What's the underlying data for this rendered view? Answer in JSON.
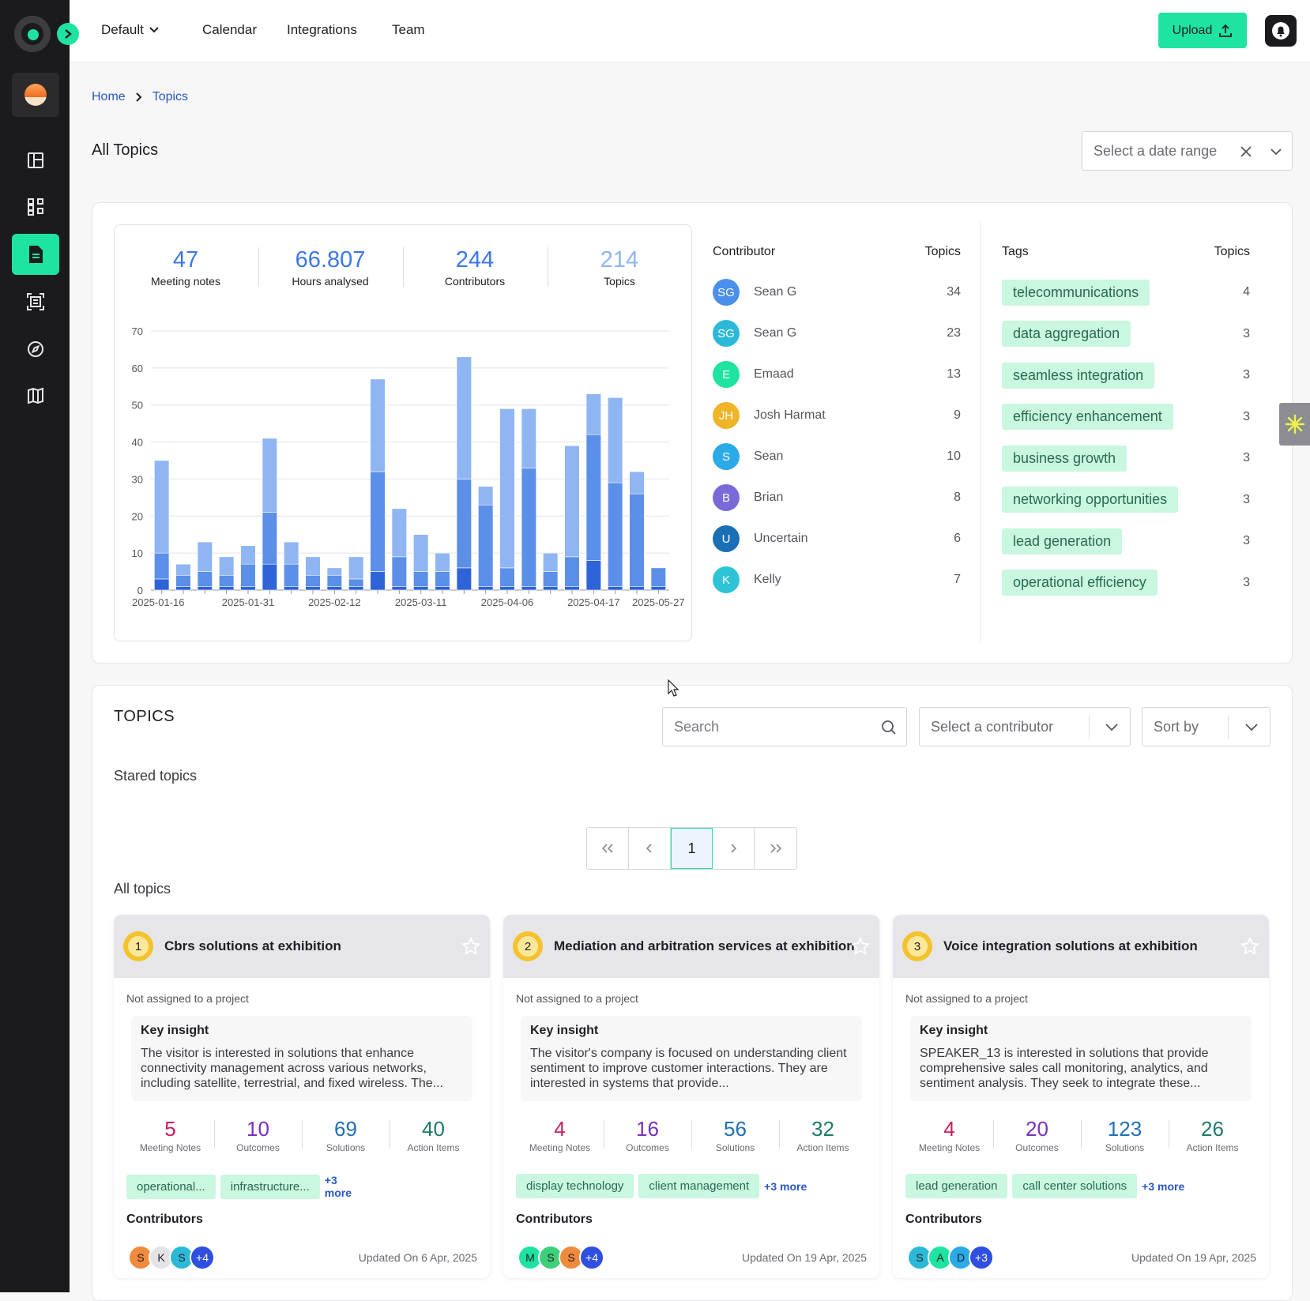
{
  "topbar": {
    "nav": [
      "Default",
      "Calendar",
      "Integrations",
      "Team"
    ],
    "upload_label": "Upload"
  },
  "sidebar": {
    "icons": [
      "dashboard-icon",
      "apps-icon",
      "document-icon",
      "scan-icon",
      "compass-icon",
      "map-icon"
    ],
    "active": "document-icon"
  },
  "breadcrumb": {
    "home": "Home",
    "current": "Topics"
  },
  "page": {
    "title": "All Topics",
    "date_placeholder": "Select a date range"
  },
  "stats": [
    {
      "value": "47",
      "label": "Meeting notes"
    },
    {
      "value": "66.807",
      "label": "Hours analysed"
    },
    {
      "value": "244",
      "label": "Contributors"
    },
    {
      "value": "214",
      "label": "Topics"
    }
  ],
  "chart_data": {
    "type": "bar",
    "stacked": true,
    "ylim": [
      0,
      70
    ],
    "yticks": [
      0,
      10,
      20,
      30,
      40,
      50,
      60,
      70
    ],
    "xtick_labels": [
      "2025-01-16",
      "2025-01-31",
      "2025-02-12",
      "2025-03-11",
      "2025-04-06",
      "2025-04-17",
      "2025-05-27"
    ],
    "grid": true,
    "series": [
      {
        "values": [
          3,
          1,
          1,
          1,
          1,
          7,
          1,
          1,
          1,
          1,
          5,
          1,
          1,
          1,
          6,
          1,
          1,
          1,
          1,
          1,
          8,
          1,
          1,
          1
        ]
      },
      {
        "values": [
          7,
          3,
          4,
          3,
          6,
          14,
          6,
          3,
          3,
          2,
          27,
          8,
          4,
          4,
          24,
          22,
          5,
          32,
          4,
          8,
          34,
          28,
          25,
          5
        ]
      },
      {
        "values": [
          25,
          3,
          8,
          5,
          5,
          20,
          6,
          5,
          2,
          6,
          25,
          13,
          10,
          5,
          33,
          5,
          43,
          16,
          5,
          30,
          11,
          23,
          6,
          0
        ]
      }
    ],
    "colors": [
      "#2f64d8",
      "#5b8fe8",
      "#8fb5f2"
    ]
  },
  "contributors": {
    "head_name": "Contributor",
    "head_count": "Topics",
    "rows": [
      {
        "initials": "SG",
        "name": "Sean G",
        "count": "34",
        "color": "#4a8fea"
      },
      {
        "initials": "SG",
        "name": "Sean G",
        "count": "23",
        "color": "#2cb9d8"
      },
      {
        "initials": "E",
        "name": "Emaad",
        "count": "13",
        "color": "#1fe3a0"
      },
      {
        "initials": "JH",
        "name": "Josh Harmat",
        "count": "9",
        "color": "#f0b429"
      },
      {
        "initials": "S",
        "name": "Sean",
        "count": "10",
        "color": "#2aaae6"
      },
      {
        "initials": "B",
        "name": "Brian",
        "count": "8",
        "color": "#7a6ad8"
      },
      {
        "initials": "U",
        "name": "Uncertain",
        "count": "6",
        "color": "#1a6fb5"
      },
      {
        "initials": "K",
        "name": "Kelly",
        "count": "7",
        "color": "#2ec4d6"
      }
    ]
  },
  "tags": {
    "head_name": "Tags",
    "head_count": "Topics",
    "rows": [
      {
        "name": "telecommunications",
        "count": "4"
      },
      {
        "name": "data aggregation",
        "count": "3"
      },
      {
        "name": "seamless integration",
        "count": "3"
      },
      {
        "name": "efficiency enhancement",
        "count": "3"
      },
      {
        "name": "business growth",
        "count": "3"
      },
      {
        "name": "networking opportunities",
        "count": "3"
      },
      {
        "name": "lead generation",
        "count": "3"
      },
      {
        "name": "operational efficiency",
        "count": "3"
      }
    ]
  },
  "topics": {
    "title": "TOPICS",
    "search_placeholder": "Search",
    "contributor_placeholder": "Select a contributor",
    "sort_placeholder": "Sort by",
    "stared_label": "Stared topics",
    "all_label": "All topics",
    "pagination": {
      "current": "1"
    },
    "cards": [
      {
        "rank": "1",
        "title": "Cbrs solutions at exhibition",
        "project": "Not assigned to a project",
        "insight_head": "Key insight",
        "insight_text": "The visitor is interested in solutions that enhance connectivity management across various networks, including satellite, terrestrial, and fixed wireless. The...",
        "metrics": [
          {
            "n": "5",
            "l": "Meeting Notes",
            "c": "#c8205f"
          },
          {
            "n": "10",
            "l": "Outcomes",
            "c": "#7a2fc0"
          },
          {
            "n": "69",
            "l": "Solutions",
            "c": "#1f6fb2"
          },
          {
            "n": "40",
            "l": "Action Items",
            "c": "#1e7a6a"
          }
        ],
        "tags": [
          "operational...",
          "infrastructure..."
        ],
        "more": "+3 more",
        "contributors_label": "Contributors",
        "avatars": [
          {
            "t": "S",
            "c": "#f08a3c"
          },
          {
            "t": "K",
            "c": "#e4e4e8"
          },
          {
            "t": "S",
            "c": "#2cb9d8"
          },
          {
            "t": "+4",
            "c": "#2f4fe0"
          }
        ],
        "updated": "Updated On 6 Apr, 2025"
      },
      {
        "rank": "2",
        "title": "Mediation and arbitration services at exhibition",
        "project": "Not assigned to a project",
        "insight_head": "Key insight",
        "insight_text": "The visitor's company is focused on understanding client sentiment to improve customer interactions. They are interested in systems that provide...",
        "metrics": [
          {
            "n": "4",
            "l": "Meeting Notes",
            "c": "#c8205f"
          },
          {
            "n": "16",
            "l": "Outcomes",
            "c": "#7a2fc0"
          },
          {
            "n": "56",
            "l": "Solutions",
            "c": "#1f6fb2"
          },
          {
            "n": "32",
            "l": "Action Items",
            "c": "#1e7a6a"
          }
        ],
        "tags": [
          "display technology",
          "client management"
        ],
        "more": "+3 more",
        "contributors_label": "Contributors",
        "avatars": [
          {
            "t": "M",
            "c": "#1fe3a0"
          },
          {
            "t": "S",
            "c": "#3dcf7a"
          },
          {
            "t": "S",
            "c": "#f08a3c"
          },
          {
            "t": "+4",
            "c": "#2f4fe0"
          }
        ],
        "updated": "Updated On 19 Apr, 2025"
      },
      {
        "rank": "3",
        "title": "Voice integration solutions at exhibition",
        "project": "Not assigned to a project",
        "insight_head": "Key insight",
        "insight_text": "SPEAKER_13 is interested in solutions that provide comprehensive sales call monitoring, analytics, and sentiment analysis. They seek to integrate these...",
        "metrics": [
          {
            "n": "4",
            "l": "Meeting Notes",
            "c": "#c8205f"
          },
          {
            "n": "20",
            "l": "Outcomes",
            "c": "#7a2fc0"
          },
          {
            "n": "123",
            "l": "Solutions",
            "c": "#1f6fb2"
          },
          {
            "n": "26",
            "l": "Action Items",
            "c": "#1e7a6a"
          }
        ],
        "tags": [
          "lead generation",
          "call center solutions"
        ],
        "more": "+3 more",
        "contributors_label": "Contributors",
        "avatars": [
          {
            "t": "S",
            "c": "#2cb9d8"
          },
          {
            "t": "A",
            "c": "#1fe3a0"
          },
          {
            "t": "D",
            "c": "#2aaae6"
          },
          {
            "t": "+3",
            "c": "#2f4fe0"
          }
        ],
        "updated": "Updated On 19 Apr, 2025"
      }
    ]
  }
}
